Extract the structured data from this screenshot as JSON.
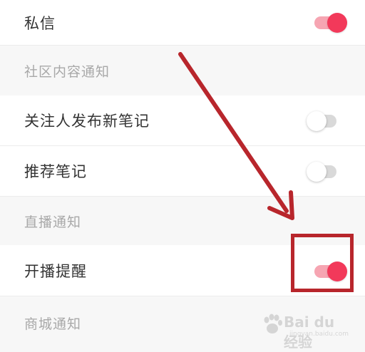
{
  "settings": {
    "private_message": {
      "label": "私信",
      "enabled": true
    },
    "section_community": "社区内容通知",
    "follow_new_notes": {
      "label": "关注人发布新笔记",
      "enabled": false
    },
    "recommended_notes": {
      "label": "推荐笔记",
      "enabled": false
    },
    "section_live": "直播通知",
    "live_start_reminder": {
      "label": "开播提醒",
      "enabled": true
    },
    "section_mall": "商城通知"
  },
  "annotation": {
    "color": "#b8262c"
  },
  "theme": {
    "accent": "#f2395a",
    "accent_track": "#f6a5b2",
    "off_track": "#d9d9d9"
  },
  "watermark": {
    "brand": "Bai du 经验",
    "url": "jingyan.baidu.com"
  }
}
